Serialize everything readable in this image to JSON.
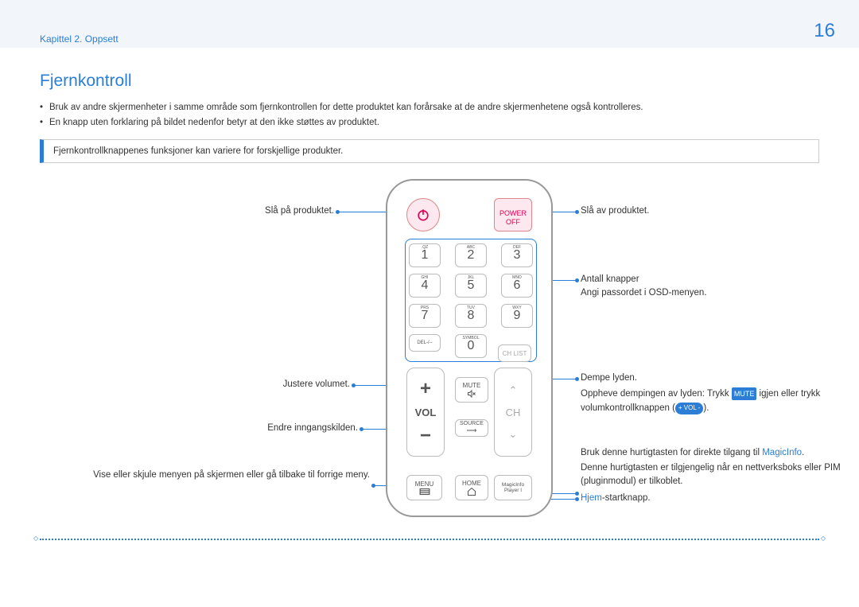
{
  "header": {
    "chapter": "Kapittel 2. Oppsett",
    "page": "16"
  },
  "title": "Fjernkontroll",
  "bullets": [
    "Bruk av andre skjermenheter i samme område som fjernkontrollen for dette produktet kan forårsake at de andre skjermenhetene også kontrolleres.",
    "En knapp uten forklaring på bildet nedenfor betyr at den ikke støttes av produktet."
  ],
  "note": "Fjernkontrollknappenes funksjoner kan variere for forskjellige produkter.",
  "remote": {
    "power_off_top": "POWER",
    "power_off_bottom": "OFF",
    "keys": [
      {
        "n": "1",
        "s": ".QZ"
      },
      {
        "n": "2",
        "s": "ABC"
      },
      {
        "n": "3",
        "s": "DEF"
      },
      {
        "n": "4",
        "s": "GHI"
      },
      {
        "n": "5",
        "s": "JKL"
      },
      {
        "n": "6",
        "s": "MNO"
      },
      {
        "n": "7",
        "s": "PRS"
      },
      {
        "n": "8",
        "s": "TUV"
      },
      {
        "n": "9",
        "s": "WXY"
      },
      {
        "n": "",
        "s": "DEL-/--"
      },
      {
        "n": "0",
        "s": "SYMBOL"
      },
      {
        "n": "",
        "s": ""
      }
    ],
    "chlist": "CH LIST",
    "vol": "VOL",
    "ch": "CH",
    "mute": "MUTE",
    "source": "SOURCE",
    "menu": "MENU",
    "home": "HOME",
    "magicinfo": "MagicInfo\nPlayer I"
  },
  "callouts": {
    "left1": "Slå på produktet.",
    "left2": "Justere volumet.",
    "left3": "Endre inngangskilden.",
    "left4": "Vise eller skjule menyen på skjermen eller gå tilbake til forrige meny.",
    "right1": "Slå av produktet.",
    "right2a": "Antall knapper",
    "right2b": "Angi passordet i OSD-menyen.",
    "right3a": "Dempe lyden.",
    "right3b_pre": "Oppheve dempingen av lyden: Trykk ",
    "right3b_mid": " igjen eller trykk volumkontrollknappen (",
    "right3b_end": ").",
    "tag_mute": "MUTE",
    "tag_vol": "+ VOL -",
    "right4a_pre": "Bruk denne hurtigtasten for direkte tilgang til ",
    "right4a_link": "MagicInfo",
    "right4a_end": ".",
    "right4b": "Denne hurtigtasten er tilgjengelig når en nettverksboks eller PIM (pluginmodul) er tilkoblet.",
    "right5_link": "Hjem",
    "right5_end": "-startknapp."
  }
}
